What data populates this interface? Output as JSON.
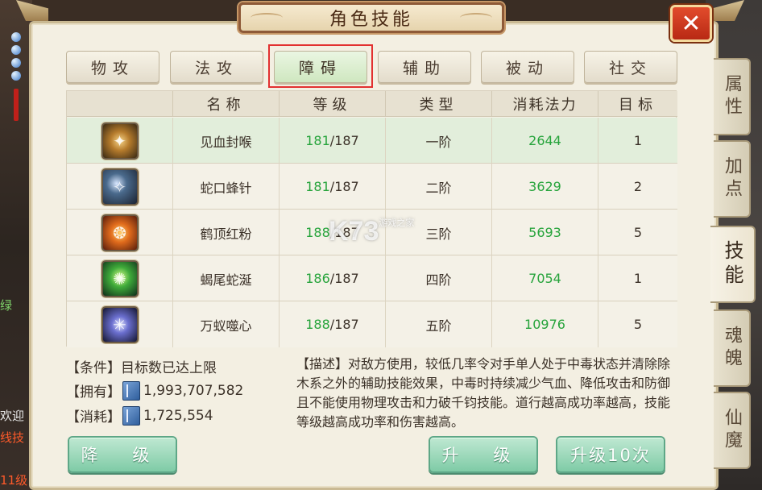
{
  "window": {
    "title": "角色技能"
  },
  "tabs": [
    {
      "label": "物攻"
    },
    {
      "label": "法攻"
    },
    {
      "label": "障碍",
      "active": true
    },
    {
      "label": "辅助"
    },
    {
      "label": "被动"
    },
    {
      "label": "社交"
    }
  ],
  "table": {
    "headers": [
      "名称",
      "等级",
      "类型",
      "消耗法力",
      "目标"
    ],
    "rows": [
      {
        "icon": "golden-flame-skill-icon",
        "name": "见血封喉",
        "level_current": "181",
        "level_max": "/187",
        "type": "一阶",
        "mana": "2644",
        "target": "1"
      },
      {
        "icon": "blue-spark-skill-icon",
        "name": "蛇口蜂针",
        "level_current": "181",
        "level_max": "/187",
        "type": "二阶",
        "mana": "3629",
        "target": "2"
      },
      {
        "icon": "red-crest-skill-icon",
        "name": "鹤顶红粉",
        "level_current": "188",
        "level_max": "/187",
        "type": "三阶",
        "mana": "5693",
        "target": "5"
      },
      {
        "icon": "green-venom-skill-icon",
        "name": "蝎尾蛇涎",
        "level_current": "186",
        "level_max": "/187",
        "type": "四阶",
        "mana": "7054",
        "target": "1"
      },
      {
        "icon": "purple-web-skill-icon",
        "name": "万蚁噬心",
        "level_current": "188",
        "level_max": "/187",
        "type": "五阶",
        "mana": "10976",
        "target": "5"
      }
    ]
  },
  "watermark": {
    "main": "K73",
    "sub": "游戏之家"
  },
  "info": {
    "condition": "【条件】目标数已达上限",
    "owned_label": "【拥有】",
    "owned_value": "1,993,707,582",
    "cost_label": "【消耗】",
    "cost_value": "1,725,554"
  },
  "description": "【描述】对敌方使用，较低几率令对手单人处于中毒状态并清除除木系之外的辅助技能效果，中毒时持续减少气血、降低攻击和防御且不能使用物理攻击和力破千钧技能。道行越高成功率越高，技能等级越高成功率和伤害越高。",
  "buttons": {
    "downgrade": "降 级",
    "upgrade": "升 级",
    "upgrade10": "升级10次"
  },
  "side_tabs": [
    {
      "label": "属性"
    },
    {
      "label": "加点"
    },
    {
      "label": "技能",
      "active": true
    },
    {
      "label": "魂魄"
    },
    {
      "label": "仙魔"
    }
  ],
  "background": {
    "left_texts": [
      "绿",
      "欢迎",
      "线技",
      "11级"
    ]
  },
  "colors": {
    "accent_green": "#27a43c",
    "highlight_red": "#e23030",
    "close_red": "#d2371e",
    "button_green": "#7fcba6"
  }
}
